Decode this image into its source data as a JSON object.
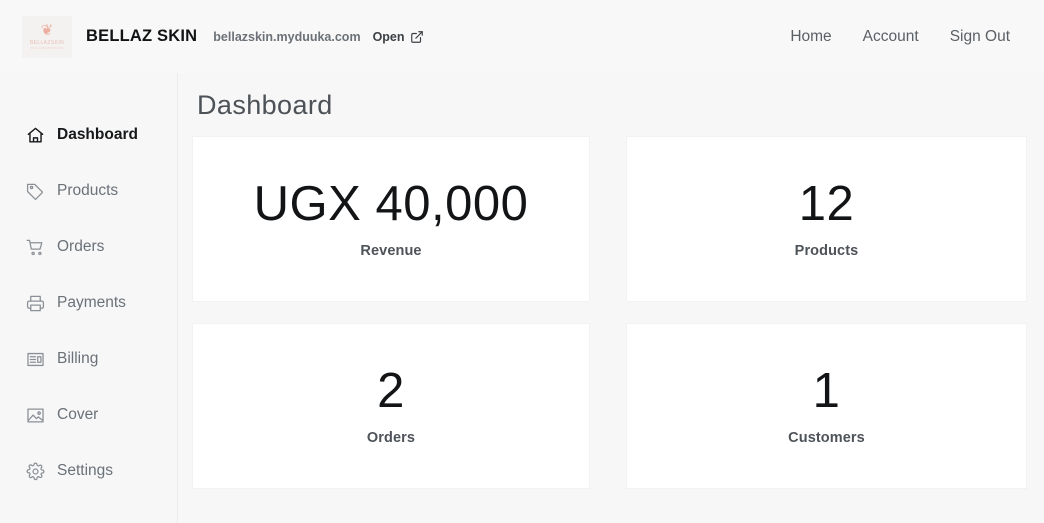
{
  "header": {
    "logo": {
      "butterfly_glyph": "❦",
      "name": "BELLAZSKIN",
      "tagline": "SKIN CARE PRODUCTS"
    },
    "store_name": "BELLAZ SKIN",
    "store_url": "bellazskin.myduuka.com",
    "open_label": "Open",
    "open_icon": "external-link-icon",
    "nav": [
      {
        "label": "Home"
      },
      {
        "label": "Account"
      },
      {
        "label": "Sign Out"
      }
    ]
  },
  "sidebar": {
    "items": [
      {
        "label": "Dashboard",
        "icon": "home-icon",
        "active": true
      },
      {
        "label": "Products",
        "icon": "tag-icon",
        "active": false
      },
      {
        "label": "Orders",
        "icon": "cart-icon",
        "active": false
      },
      {
        "label": "Payments",
        "icon": "printer-icon",
        "active": false
      },
      {
        "label": "Billing",
        "icon": "article-icon",
        "active": false
      },
      {
        "label": "Cover",
        "icon": "image-icon",
        "active": false
      },
      {
        "label": "Settings",
        "icon": "gear-icon",
        "active": false
      }
    ]
  },
  "main": {
    "title": "Dashboard",
    "cards": [
      {
        "value": "UGX 40,000",
        "label": "Revenue"
      },
      {
        "value": "12",
        "label": "Products"
      },
      {
        "value": "2",
        "label": "Orders"
      },
      {
        "value": "1",
        "label": "Customers"
      }
    ]
  },
  "colors": {
    "page_background": "#f7f7f7",
    "card_background": "#ffffff",
    "text_primary": "#16181a",
    "text_muted": "#6a7178",
    "brand_accent": "#eba390"
  }
}
